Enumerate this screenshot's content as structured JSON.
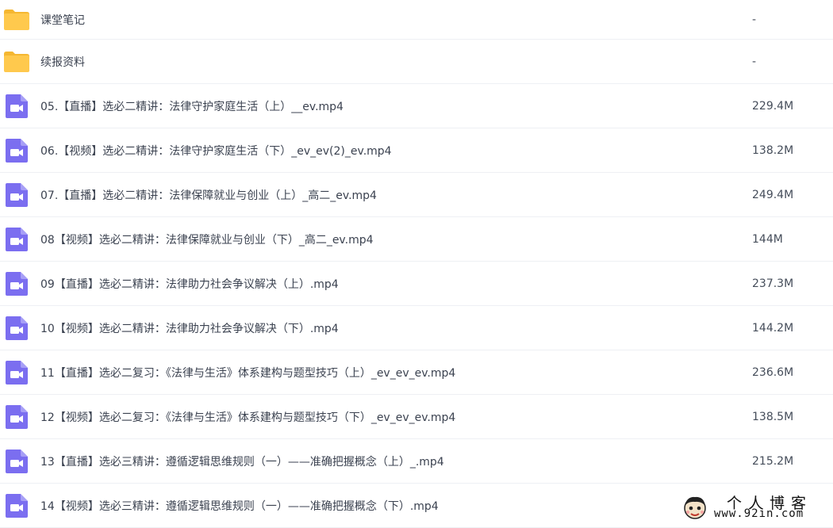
{
  "files": [
    {
      "type": "folder",
      "name": "课堂笔记",
      "size": "-"
    },
    {
      "type": "folder",
      "name": "续报资料",
      "size": "-"
    },
    {
      "type": "video",
      "name": "05.【直播】选必二精讲：法律守护家庭生活（上）__ev.mp4",
      "size": "229.4M"
    },
    {
      "type": "video",
      "name": "06.【视频】选必二精讲：法律守护家庭生活（下）_ev_ev(2)_ev.mp4",
      "size": "138.2M"
    },
    {
      "type": "video",
      "name": "07.【直播】选必二精讲：法律保障就业与创业（上）_高二_ev.mp4",
      "size": "249.4M"
    },
    {
      "type": "video",
      "name": "08【视频】选必二精讲：法律保障就业与创业（下）_高二_ev.mp4",
      "size": "144M"
    },
    {
      "type": "video",
      "name": "09【直播】选必二精讲：法律助力社会争议解决（上）.mp4",
      "size": "237.3M"
    },
    {
      "type": "video",
      "name": "10【视频】选必二精讲：法律助力社会争议解决（下）.mp4",
      "size": "144.2M"
    },
    {
      "type": "video",
      "name": "11【直播】选必二复习：《法律与生活》体系建构与题型技巧（上）_ev_ev_ev.mp4",
      "size": "236.6M"
    },
    {
      "type": "video",
      "name": "12【视频】选必二复习：《法律与生活》体系建构与题型技巧（下）_ev_ev_ev.mp4",
      "size": "138.5M"
    },
    {
      "type": "video",
      "name": "13【直播】选必三精讲：遵循逻辑思维规则（一）——准确把握概念（上）_.mp4",
      "size": "215.2M"
    },
    {
      "type": "video",
      "name": "14【视频】选必三精讲：遵循逻辑思维规则（一）——准确把握概念（下）.mp4",
      "size": ""
    }
  ],
  "watermark": {
    "title": "个人博客",
    "url": "www.92in.com"
  },
  "colors": {
    "folder": "#ffc94d",
    "folder_tab": "#f5b731",
    "video": "#7b6ef0",
    "divider": "#eef0f4"
  },
  "icons": {
    "folder": "folder-icon",
    "video": "video-file-icon"
  }
}
